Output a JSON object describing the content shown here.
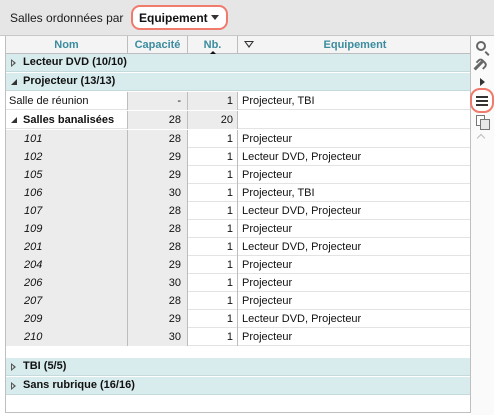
{
  "toolbar": {
    "label": "Salles ordonnées par",
    "dropdown_value": "Equipement",
    "highlight_color": "#f07a6c"
  },
  "columns": {
    "nom": "Nom",
    "capacite": "Capacité",
    "nb": "Nb.",
    "equipement": "Equipement"
  },
  "colors": {
    "header_text": "#3a8c9e",
    "group_bg": "#d8ebed"
  },
  "groups": [
    {
      "label": "Lecteur DVD (10/10)",
      "expanded": false
    },
    {
      "label": "Projecteur (13/13)",
      "expanded": true
    },
    {
      "label": "TBI (5/5)",
      "expanded": false
    },
    {
      "label": "Sans rubrique (16/16)",
      "expanded": false
    }
  ],
  "rows": [
    {
      "nom": "Salle de réunion",
      "capacite": "-",
      "nb": "1",
      "equipement": "Projecteur, TBI"
    },
    {
      "nom": "Salles banalisées",
      "capacite": "28",
      "nb": "20",
      "equipement": ""
    },
    {
      "nom": "101",
      "capacite": "28",
      "nb": "1",
      "equipement": "Projecteur"
    },
    {
      "nom": "102",
      "capacite": "29",
      "nb": "1",
      "equipement": "Lecteur DVD, Projecteur"
    },
    {
      "nom": "105",
      "capacite": "29",
      "nb": "1",
      "equipement": "Projecteur"
    },
    {
      "nom": "106",
      "capacite": "30",
      "nb": "1",
      "equipement": "Projecteur, TBI"
    },
    {
      "nom": "107",
      "capacite": "28",
      "nb": "1",
      "equipement": "Lecteur DVD, Projecteur"
    },
    {
      "nom": "109",
      "capacite": "28",
      "nb": "1",
      "equipement": "Projecteur"
    },
    {
      "nom": "201",
      "capacite": "28",
      "nb": "1",
      "equipement": "Lecteur DVD, Projecteur"
    },
    {
      "nom": "204",
      "capacite": "29",
      "nb": "1",
      "equipement": "Projecteur"
    },
    {
      "nom": "206",
      "capacite": "30",
      "nb": "1",
      "equipement": "Projecteur"
    },
    {
      "nom": "207",
      "capacite": "28",
      "nb": "1",
      "equipement": "Projecteur"
    },
    {
      "nom": "209",
      "capacite": "29",
      "nb": "1",
      "equipement": "Lecteur DVD, Projecteur"
    },
    {
      "nom": "210",
      "capacite": "30",
      "nb": "1",
      "equipement": "Projecteur"
    }
  ],
  "sidebar_icons": [
    "search-icon",
    "wrench-icon",
    "expand-arrow-icon",
    "menu-icon",
    "copy-icon",
    "collapse-caret-icon"
  ]
}
